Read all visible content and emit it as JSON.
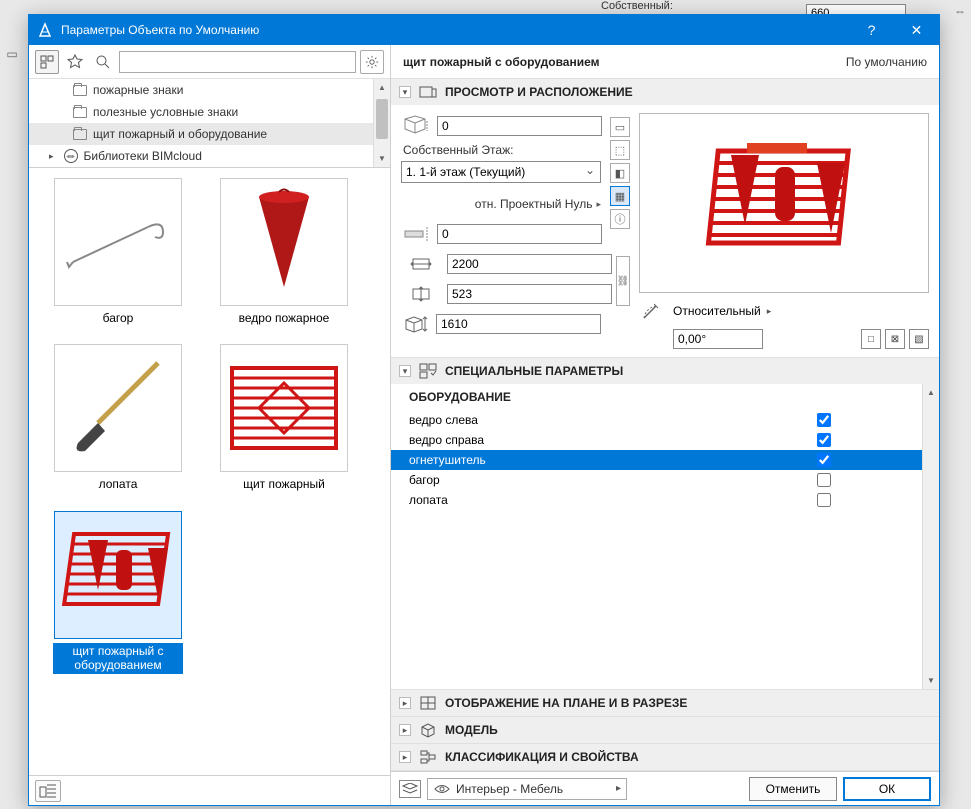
{
  "background": {
    "own_label": "Собственный:",
    "value": "660"
  },
  "titlebar": {
    "title": "Параметры Объекта по Умолчанию",
    "help": "?",
    "close": "✕"
  },
  "toolbar": {
    "search_placeholder": ""
  },
  "tree": {
    "items": [
      {
        "label": "пожарные знаки"
      },
      {
        "label": "полезные условные знаки"
      },
      {
        "label": "щит пожарный и оборудование"
      }
    ],
    "root": "Библиотеки BIMcloud"
  },
  "gallery": {
    "items": [
      {
        "label": "багор"
      },
      {
        "label": "ведро пожарное"
      },
      {
        "label": "лопата"
      },
      {
        "label": "щит пожарный"
      },
      {
        "label": "щит пожарный с оборудованием"
      }
    ]
  },
  "right": {
    "title": "щит пожарный с оборудованием",
    "default": "По умолчанию"
  },
  "sections": {
    "preview": {
      "title": "ПРОСМОТР И РАСПОЛОЖЕНИЕ",
      "z": "0",
      "story_label": "Собственный Этаж:",
      "story_value": "1. 1-й этаж (Текущий)",
      "proj_zero": "отн. Проектный Нуль",
      "z2": "0",
      "w": "2200",
      "d": "523",
      "h": "1610",
      "relative": "Относительный",
      "angle": "0,00°"
    },
    "special": {
      "title": "СПЕЦИАЛЬНЫЕ ПАРАМЕТРЫ",
      "equip_head": "ОБОРУДОВАНИЕ",
      "rows": [
        {
          "name": "ведро слева",
          "checked": true
        },
        {
          "name": "ведро справа",
          "checked": true
        },
        {
          "name": "огнетушитель",
          "checked": true,
          "selected": true
        },
        {
          "name": "багор",
          "checked": false
        },
        {
          "name": "лопата",
          "checked": false
        }
      ]
    },
    "plan": {
      "title": "ОТОБРАЖЕНИЕ НА ПЛАНЕ И В РАЗРЕЗЕ"
    },
    "model": {
      "title": "МОДЕЛЬ"
    },
    "class": {
      "title": "КЛАССИФИКАЦИЯ И СВОЙСТВА"
    }
  },
  "footer": {
    "layer": "Интерьер - Мебель",
    "cancel": "Отменить",
    "ok": "ОК"
  }
}
